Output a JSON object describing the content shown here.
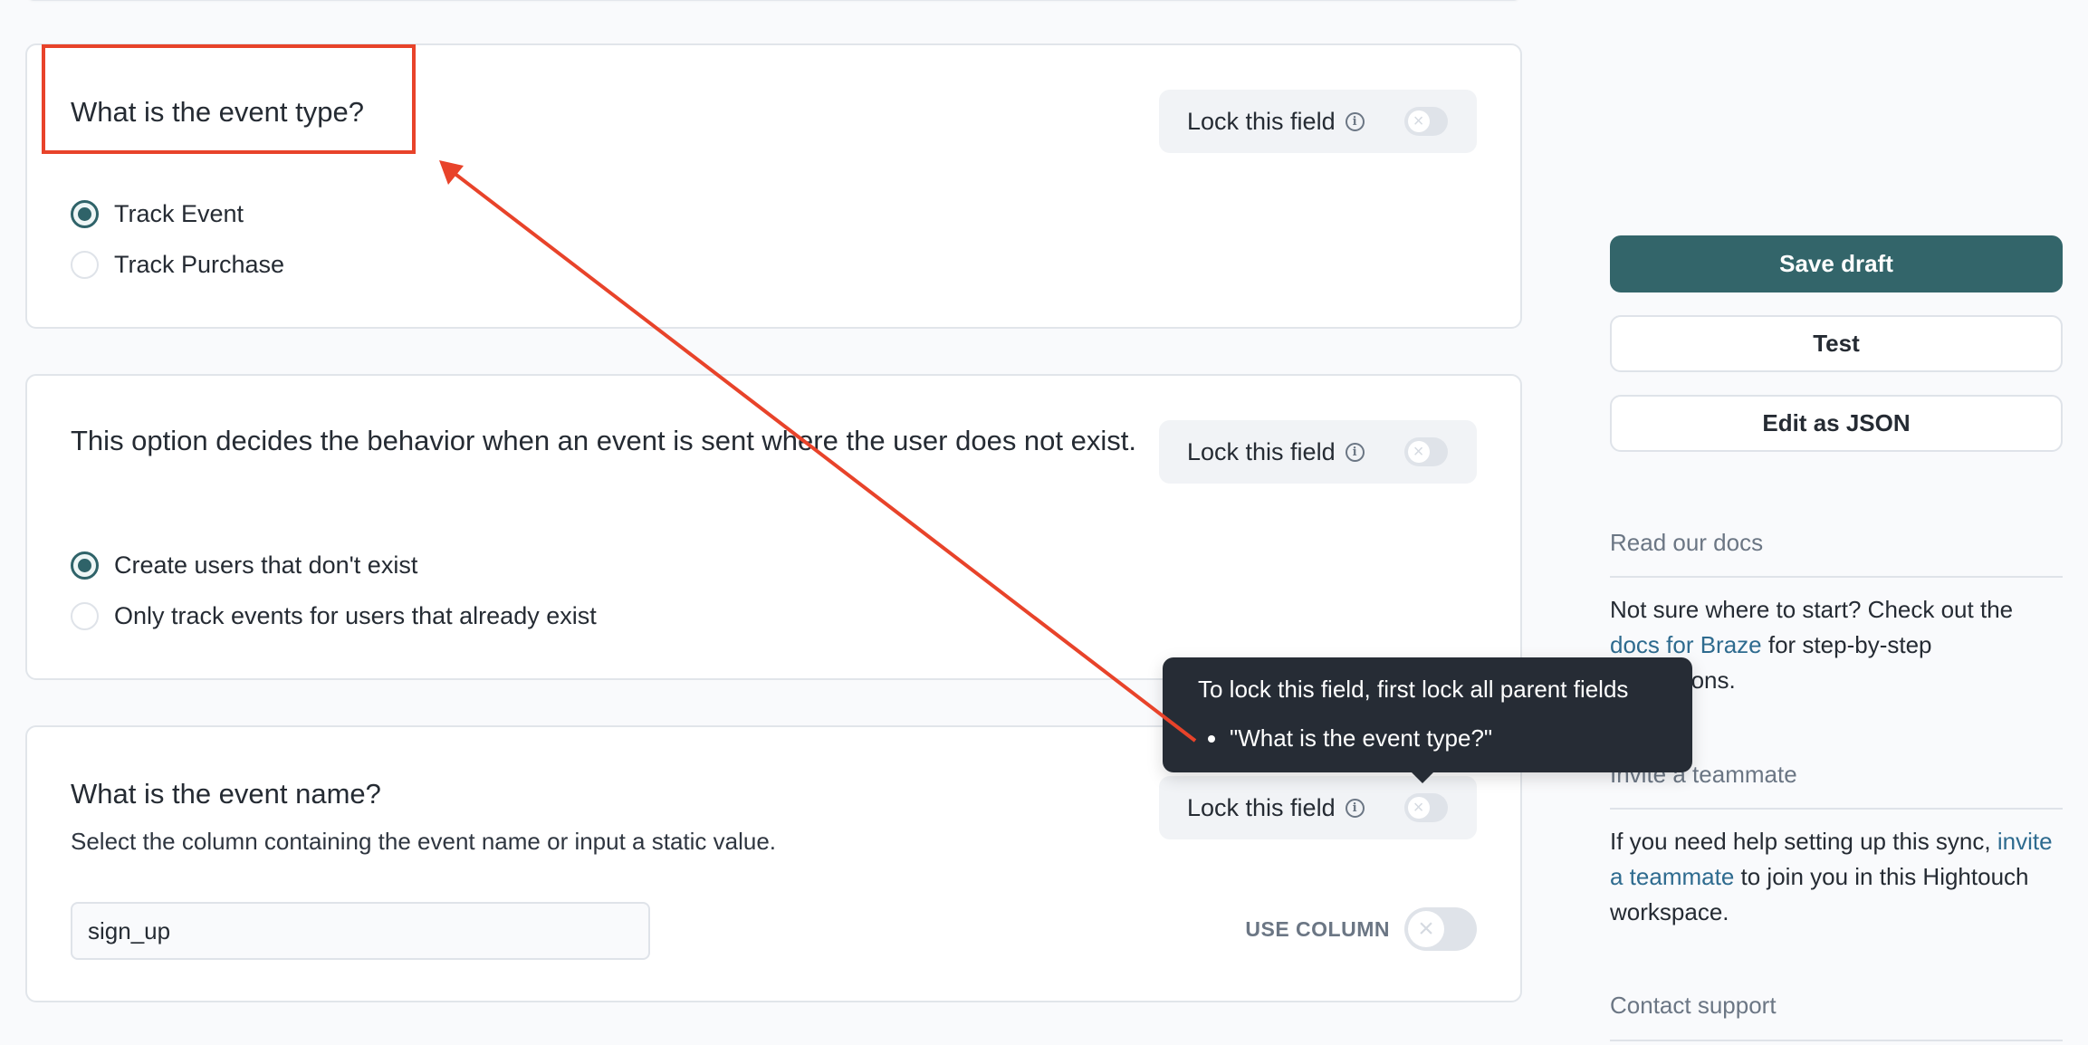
{
  "colors": {
    "accent": "#33656a",
    "annotation": "#e8432a",
    "link": "#2e6b8f",
    "tooltip_bg": "#262c35"
  },
  "cards": [
    {
      "title": "What is the event type?",
      "lock_label": "Lock this field",
      "lock_enabled": false,
      "options": [
        {
          "label": "Track Event",
          "selected": true
        },
        {
          "label": "Track Purchase",
          "selected": false
        }
      ]
    },
    {
      "title": "This option decides the behavior when an event is sent where the user does not exist.",
      "lock_label": "Lock this field",
      "lock_enabled": false,
      "options": [
        {
          "label": "Create users that don't exist",
          "selected": true
        },
        {
          "label": "Only track events for users that already exist",
          "selected": false
        }
      ]
    },
    {
      "title": "What is the event name?",
      "description": "Select the column containing the event name or input a static value.",
      "lock_label": "Lock this field",
      "lock_enabled": false,
      "input_value": "sign_up",
      "use_column_label": "USE COLUMN",
      "use_column_enabled": false
    }
  ],
  "tooltip": {
    "title": "To lock this field, first lock all parent fields",
    "items": [
      "\"What is the event type?\""
    ]
  },
  "sidebar": {
    "save_draft": "Save draft",
    "test": "Test",
    "edit_json": "Edit as JSON",
    "sections": [
      {
        "heading": "Read our docs",
        "text_before": "Not sure where to start? Check out the ",
        "link": "docs for Braze",
        "text_after": " for step-by-step instructions."
      },
      {
        "heading": "Invite a teammate",
        "text_before": "If you need help setting up this sync, ",
        "link": "invite a teammate",
        "text_after": " to join you in this Hightouch workspace."
      },
      {
        "heading": "Contact support"
      }
    ]
  },
  "icons": {
    "info": "info-icon",
    "toggle_off": "x-icon"
  }
}
